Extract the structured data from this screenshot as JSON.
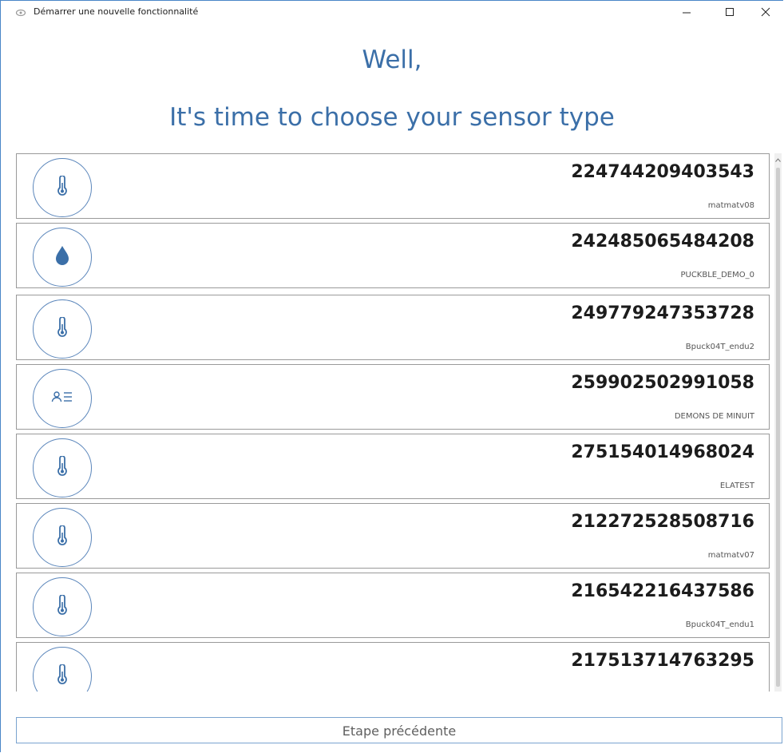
{
  "window": {
    "title": "Démarrer une nouvelle fonctionnalité",
    "controls": {
      "minimize_icon": "minimize-icon",
      "maximize_icon": "maximize-icon",
      "close_icon": "close-icon"
    }
  },
  "header": {
    "greeting": "Well,",
    "prompt": "It's time to choose your sensor type"
  },
  "sensors": [
    {
      "icon": "thermometer-icon",
      "id": "224744209403543",
      "name": "matmatv08"
    },
    {
      "icon": "water-drop-icon",
      "id": "242485065484208",
      "name": "PUCKBLE_DEMO_0"
    },
    {
      "icon": "thermometer-icon",
      "id": "249779247353728",
      "name": "Bpuck04T_endu2"
    },
    {
      "icon": "person-list-icon",
      "id": "259902502991058",
      "name": "DEMONS DE MINUIT"
    },
    {
      "icon": "thermometer-icon",
      "id": "275154014968024",
      "name": "ELATEST"
    },
    {
      "icon": "thermometer-icon",
      "id": "212272528508716",
      "name": "matmatv07"
    },
    {
      "icon": "thermometer-icon",
      "id": "216542216437586",
      "name": "Bpuck04T_endu1"
    },
    {
      "icon": "thermometer-icon",
      "id": "217513714763295",
      "name": ""
    }
  ],
  "footer": {
    "previous_label": "Etape précédente"
  },
  "colors": {
    "accent": "#3b6fa8",
    "icon_stroke": "#5b86bb",
    "window_border": "#4a86c8"
  }
}
